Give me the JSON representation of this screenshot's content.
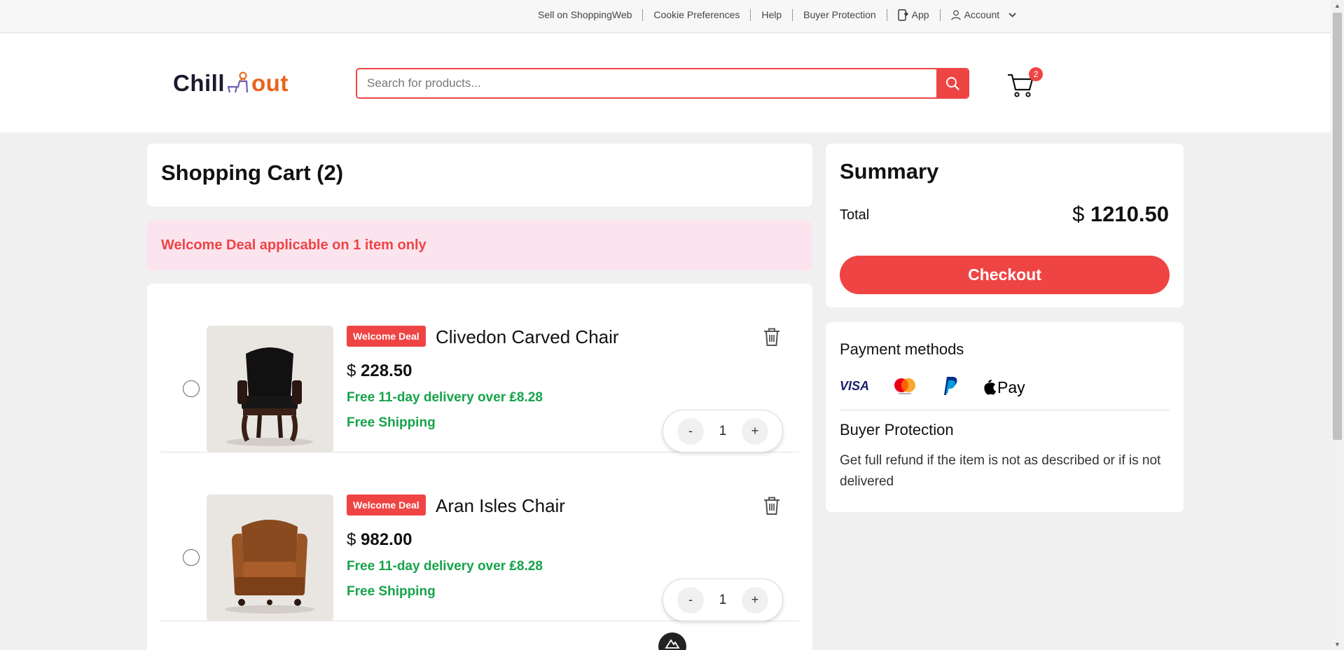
{
  "topbar": {
    "links": [
      "Sell on ShoppingWeb",
      "Cookie Preferences",
      "Help",
      "Buyer Protection"
    ],
    "app_label": "App",
    "account_label": "Account"
  },
  "header": {
    "logo_part1": "Chill",
    "logo_part2": "out",
    "search_placeholder": "Search for products...",
    "cart_count": "2",
    "accent_color": "#ef4444"
  },
  "cart": {
    "title": "Shopping Cart (2)",
    "deal_banner": "Welcome Deal applicable on 1 item only",
    "items": [
      {
        "badge": "Welcome Deal",
        "name": "Clivedon Carved Chair",
        "currency": "$",
        "price": "228.50",
        "delivery": "Free 11-day delivery over ₤8.28",
        "shipping": "Free Shipping",
        "qty": "1",
        "minus": "-",
        "plus": "+",
        "image_icon": "black-leather-chair"
      },
      {
        "badge": "Welcome Deal",
        "name": "Aran Isles Chair",
        "currency": "$",
        "price": "982.00",
        "delivery": "Free 11-day delivery over ₤8.28",
        "shipping": "Free Shipping",
        "qty": "1",
        "minus": "-",
        "plus": "+",
        "image_icon": "brown-leather-armchair"
      }
    ]
  },
  "summary": {
    "title": "Summary",
    "total_label": "Total",
    "currency": "$",
    "total_value": "1210.50",
    "checkout_label": "Checkout"
  },
  "payment": {
    "title": "Payment methods",
    "methods": [
      "VISA",
      "mastercard",
      "PayPal",
      "Pay"
    ],
    "protection_title": "Buyer Protection",
    "protection_text": "Get full refund if the item is not as described or if is not delivered"
  }
}
